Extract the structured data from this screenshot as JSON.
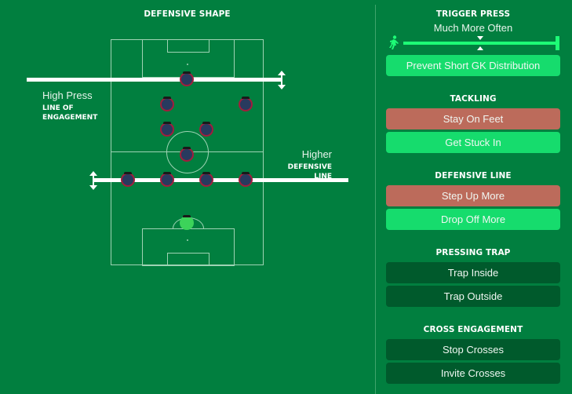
{
  "left": {
    "title": "DEFENSIVE SHAPE",
    "line_of_engagement": {
      "value": "High Press",
      "label": "LINE OF ENGAGEMENT"
    },
    "defensive_line": {
      "value": "Higher",
      "label": "DEFENSIVE LINE"
    },
    "players": [
      {
        "role": "striker"
      },
      {
        "role": "winger-left"
      },
      {
        "role": "winger-right"
      },
      {
        "role": "cm-left"
      },
      {
        "role": "cm-right"
      },
      {
        "role": "dm"
      },
      {
        "role": "fb-left"
      },
      {
        "role": "cb-left"
      },
      {
        "role": "cb-right"
      },
      {
        "role": "fb-right"
      },
      {
        "role": "goalkeeper"
      }
    ]
  },
  "right": {
    "trigger_press": {
      "title": "TRIGGER PRESS",
      "value": "Much More Often",
      "slider_marker_fraction": 0.5,
      "slider_fill_fraction": 1.0,
      "option": {
        "label": "Prevent Short GK Distribution",
        "state": "on"
      }
    },
    "tackling": {
      "title": "TACKLING",
      "options": [
        {
          "label": "Stay On Feet",
          "state": "neg"
        },
        {
          "label": "Get Stuck In",
          "state": "on"
        }
      ]
    },
    "defensive_line": {
      "title": "DEFENSIVE LINE",
      "options": [
        {
          "label": "Step Up More",
          "state": "neg"
        },
        {
          "label": "Drop Off More",
          "state": "on"
        }
      ]
    },
    "pressing_trap": {
      "title": "PRESSING TRAP",
      "options": [
        {
          "label": "Trap Inside",
          "state": "off"
        },
        {
          "label": "Trap Outside",
          "state": "off"
        }
      ]
    },
    "cross_engagement": {
      "title": "CROSS ENGAGEMENT",
      "options": [
        {
          "label": "Stop Crosses",
          "state": "off"
        },
        {
          "label": "Invite Crosses",
          "state": "off"
        }
      ]
    }
  },
  "colors": {
    "background": "#017f3f",
    "active": "#16dc6d",
    "negative": "#bc6b5b",
    "inactive": "#005a2c",
    "slider": "#1dfb76",
    "player_fill": "#283a5e",
    "player_ring": "#a01e3c",
    "keeper": "#3cd35a"
  }
}
